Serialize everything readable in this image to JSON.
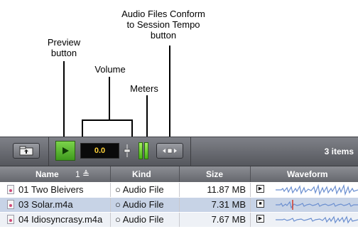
{
  "callouts": {
    "audio_files_conform": "Audio Files Conform\nto Session Tempo\nbutton",
    "preview": "Preview\nbutton",
    "volume": "Volume",
    "meters": "Meters"
  },
  "toolbar": {
    "volume_value": "0.0",
    "items_count": "3 items"
  },
  "columns": {
    "name": "Name",
    "sort_indicator": "1 ≜",
    "kind": "Kind",
    "size": "Size",
    "waveform": "Waveform"
  },
  "rows": [
    {
      "name": "01 Two Bleivers",
      "kind": "Audio File",
      "size": "11.87 MB",
      "selected": false
    },
    {
      "name": "03 Solar.m4a",
      "kind": "Audio File",
      "size": "7.31 MB",
      "selected": true
    },
    {
      "name": "04 Idiosyncrasy.m4a",
      "kind": "Audio File",
      "size": "7.67 MB",
      "selected": false
    }
  ],
  "colors": {
    "row_even": "#ffffff",
    "row_selected": "#c7d3e6",
    "row_odd": "#eef1f6",
    "waveform": "#6b8fd0"
  }
}
